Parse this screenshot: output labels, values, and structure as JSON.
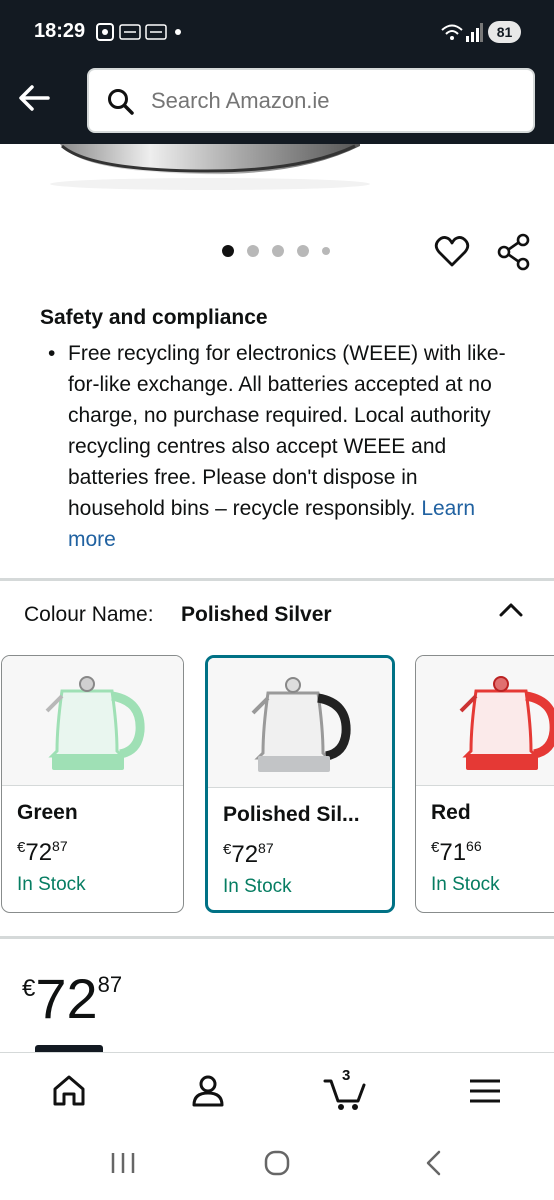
{
  "status_bar": {
    "time": "18:29",
    "battery": "81",
    "icons": [
      "screen-record-icon",
      "temu-notification-icon",
      "temu-notification-icon",
      "wifi-icon",
      "signal-icon"
    ]
  },
  "header": {
    "back_icon": "back-arrow-icon",
    "search": {
      "placeholder": "Search Amazon.ie",
      "icon": "search-icon"
    }
  },
  "gallery": {
    "dots_total": 5,
    "active_dot": 1,
    "actions": [
      "heart-icon",
      "share-icon"
    ]
  },
  "safety": {
    "title": "Safety and compliance",
    "bullet": "•",
    "text": "Free recycling for electronics (WEEE) with like-for-like exchange. All batteries accepted at no charge, no purchase required. Local authority recycling centres also accept WEEE and batteries free. Please don't dispose in household bins – recycle responsibly.",
    "learn_more": "Learn more"
  },
  "colour": {
    "label": "Colour Name:",
    "selected": "Polished Silver",
    "options": [
      {
        "name": "Green",
        "currency": "€",
        "whole": "72",
        "fraction": "87",
        "stock": "In Stock",
        "color": "#9fe0b5"
      },
      {
        "name": "Polished Sil...",
        "currency": "€",
        "whole": "72",
        "fraction": "87",
        "stock": "In Stock",
        "color": "#b9bcbf"
      },
      {
        "name": "Red",
        "currency": "€",
        "whole": "71",
        "fraction": "66",
        "stock": "In Stock",
        "color": "#e53935"
      }
    ]
  },
  "price": {
    "currency": "€",
    "whole": "72",
    "fraction": "87"
  },
  "bottom_nav": {
    "items": [
      "home-icon",
      "account-icon",
      "cart-icon",
      "menu-icon"
    ],
    "cart_count": "3"
  },
  "system_nav": [
    "recents-icon",
    "home-circle-icon",
    "back-chevron-icon"
  ],
  "colors": {
    "header": "#131a22",
    "link": "#2162a1",
    "in_stock": "#067d62",
    "selected_border": "#007185"
  }
}
